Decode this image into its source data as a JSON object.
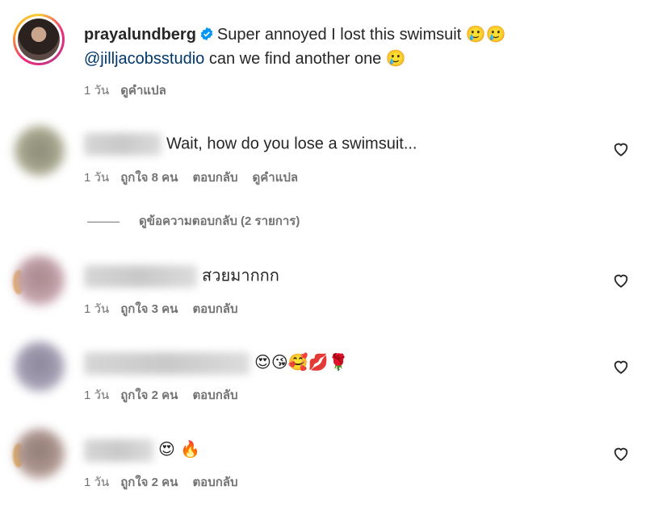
{
  "post": {
    "username": "prayalundberg",
    "caption_line1": "Super annoyed I lost this swimsuit 🥲🥲",
    "mention": "@jilljacobsstudio",
    "caption_line2_rest": " can we find another one 🥲",
    "time": "1 วัน",
    "translate": "ดูคำแปล"
  },
  "comments": [
    {
      "text": "Wait, how do you lose a swimsuit...",
      "time": "1 วัน",
      "likes": "ถูกใจ 8 คน",
      "reply": "ตอบกลับ",
      "translate": "ดูคำแปล",
      "view_replies": "ดูข้อความตอบกลับ (2 รายการ)"
    },
    {
      "text": "สวยมากกก",
      "time": "1 วัน",
      "likes": "ถูกใจ 3 คน",
      "reply": "ตอบกลับ"
    },
    {
      "text": "😍😘🥰💋🌹",
      "time": "1 วัน",
      "likes": "ถูกใจ 2 คน",
      "reply": "ตอบกลับ"
    },
    {
      "text": "😍 🔥",
      "time": "1 วัน",
      "likes": "ถูกใจ 2 คน",
      "reply": "ตอบกลับ"
    }
  ],
  "icons": {
    "verified": "verified-badge-icon",
    "like": "heart-outline-icon"
  },
  "colors": {
    "text": "#262626",
    "secondary": "#737373",
    "mention": "#00376b",
    "verified": "#0095f6"
  }
}
